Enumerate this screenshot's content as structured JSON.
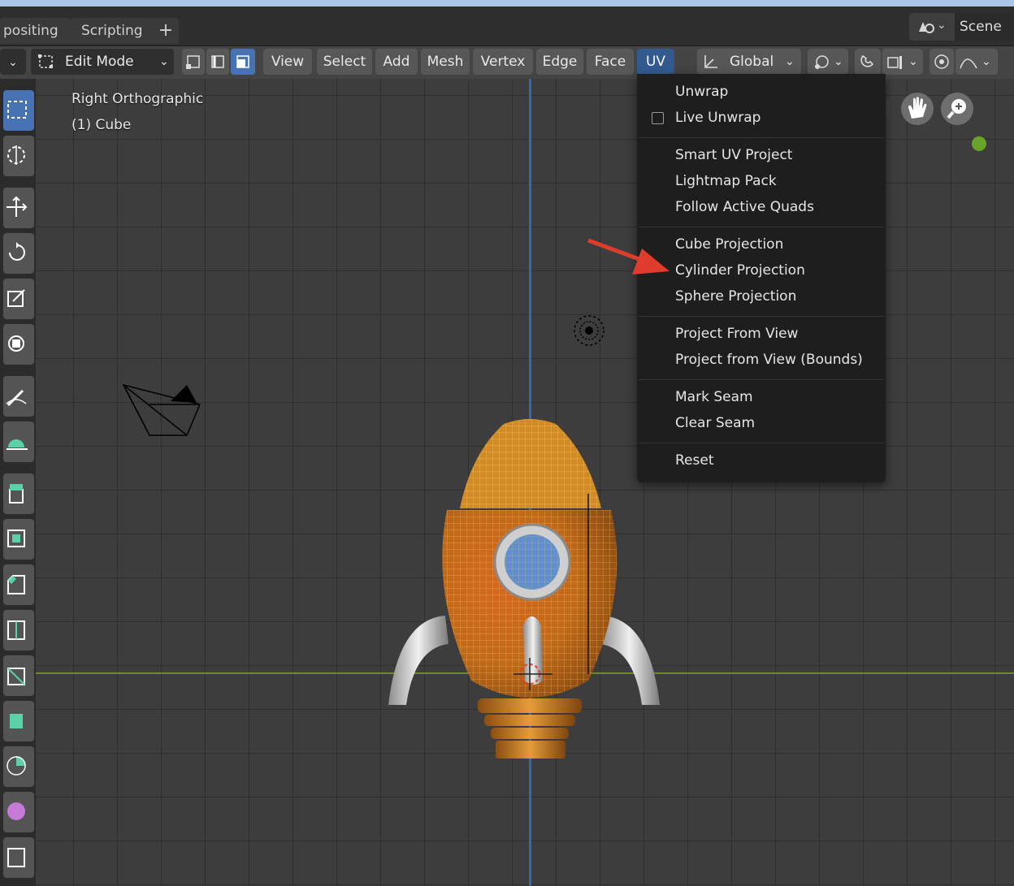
{
  "workspace_tabs": [
    {
      "label": "positing"
    },
    {
      "label": "Scripting"
    },
    {
      "label": "+"
    }
  ],
  "scene": {
    "label": "Scene",
    "icon": "scene-icon"
  },
  "header": {
    "mode_label": "Edit Mode",
    "menus": [
      "View",
      "Select",
      "Add",
      "Mesh",
      "Vertex",
      "Edge",
      "Face",
      "UV"
    ],
    "transform_orientation": "Global",
    "select_modes": [
      "vertex-select-icon",
      "edge-select-icon",
      "face-select-icon"
    ]
  },
  "viewport": {
    "view_name": "Right Orthographic",
    "object_name": "(1) Cube"
  },
  "uv_menu": {
    "groups": [
      [
        "Unwrap",
        "Live Unwrap"
      ],
      [
        "Smart UV Project",
        "Lightmap Pack",
        "Follow Active Quads"
      ],
      [
        "Cube Projection",
        "Cylinder Projection",
        "Sphere Projection"
      ],
      [
        "Project From View",
        "Project from View (Bounds)"
      ],
      [
        "Mark Seam",
        "Clear Seam"
      ],
      [
        "Reset"
      ]
    ],
    "live_unwrap_checked": false
  },
  "colors": {
    "accent": "#4772b3",
    "menu_bg": "#1e1e1e",
    "y_axis": "#2c6bb0",
    "x_axis": "#6b8a24",
    "arrow": "#e03c2d"
  }
}
